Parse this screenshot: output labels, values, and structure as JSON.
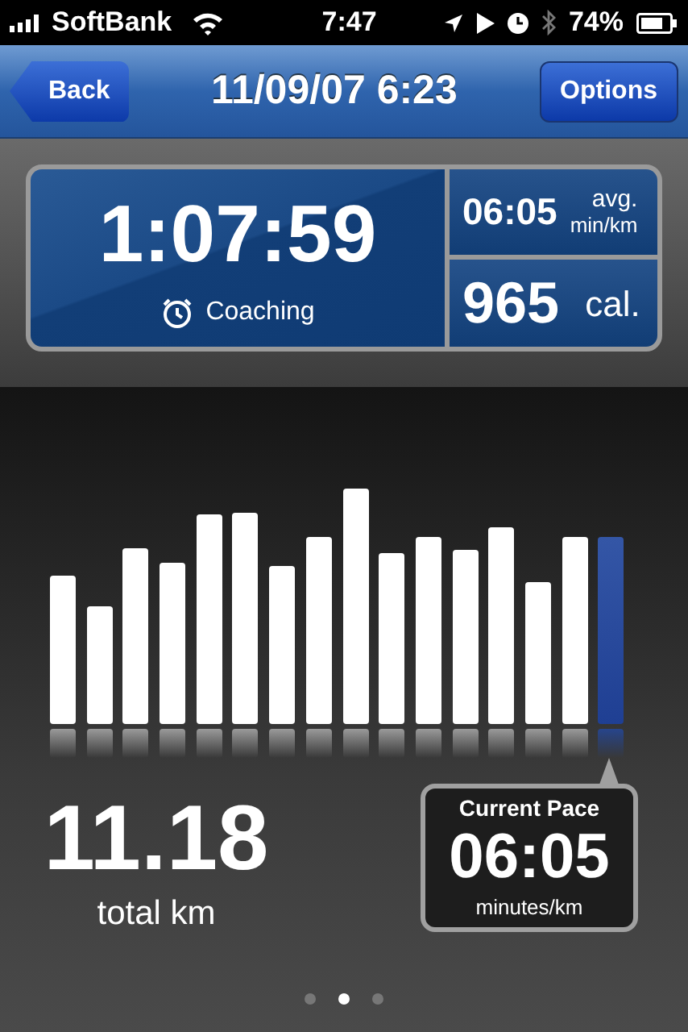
{
  "status_bar": {
    "carrier": "SoftBank",
    "time": "7:47",
    "battery": "74%"
  },
  "nav_bar": {
    "back": "Back",
    "title": "11/09/07 6:23",
    "options": "Options"
  },
  "summary": {
    "duration": "1:07:59",
    "coaching": "Coaching",
    "avg_pace": "06:05",
    "avg_label": "avg.",
    "avg_unit": "min/km",
    "calories": "965",
    "calories_unit": "cal."
  },
  "pace_bars": [
    {
      "selected": false
    },
    {
      "selected": false
    },
    {
      "selected": false
    },
    {
      "selected": false
    },
    {
      "selected": false
    },
    {
      "selected": false
    },
    {
      "selected": false
    },
    {
      "selected": false
    },
    {
      "selected": false
    },
    {
      "selected": false
    },
    {
      "selected": false
    },
    {
      "selected": false
    },
    {
      "selected": false
    },
    {
      "selected": false
    },
    {
      "selected": false
    },
    {
      "selected": true
    }
  ],
  "distance": {
    "value": "11.18",
    "label": "total km"
  },
  "current_pace": {
    "title": "Current Pace",
    "value": "06:05",
    "unit": "minutes/km"
  },
  "pages": [
    {
      "selected": false
    },
    {
      "selected": true
    },
    {
      "selected": false
    }
  ]
}
